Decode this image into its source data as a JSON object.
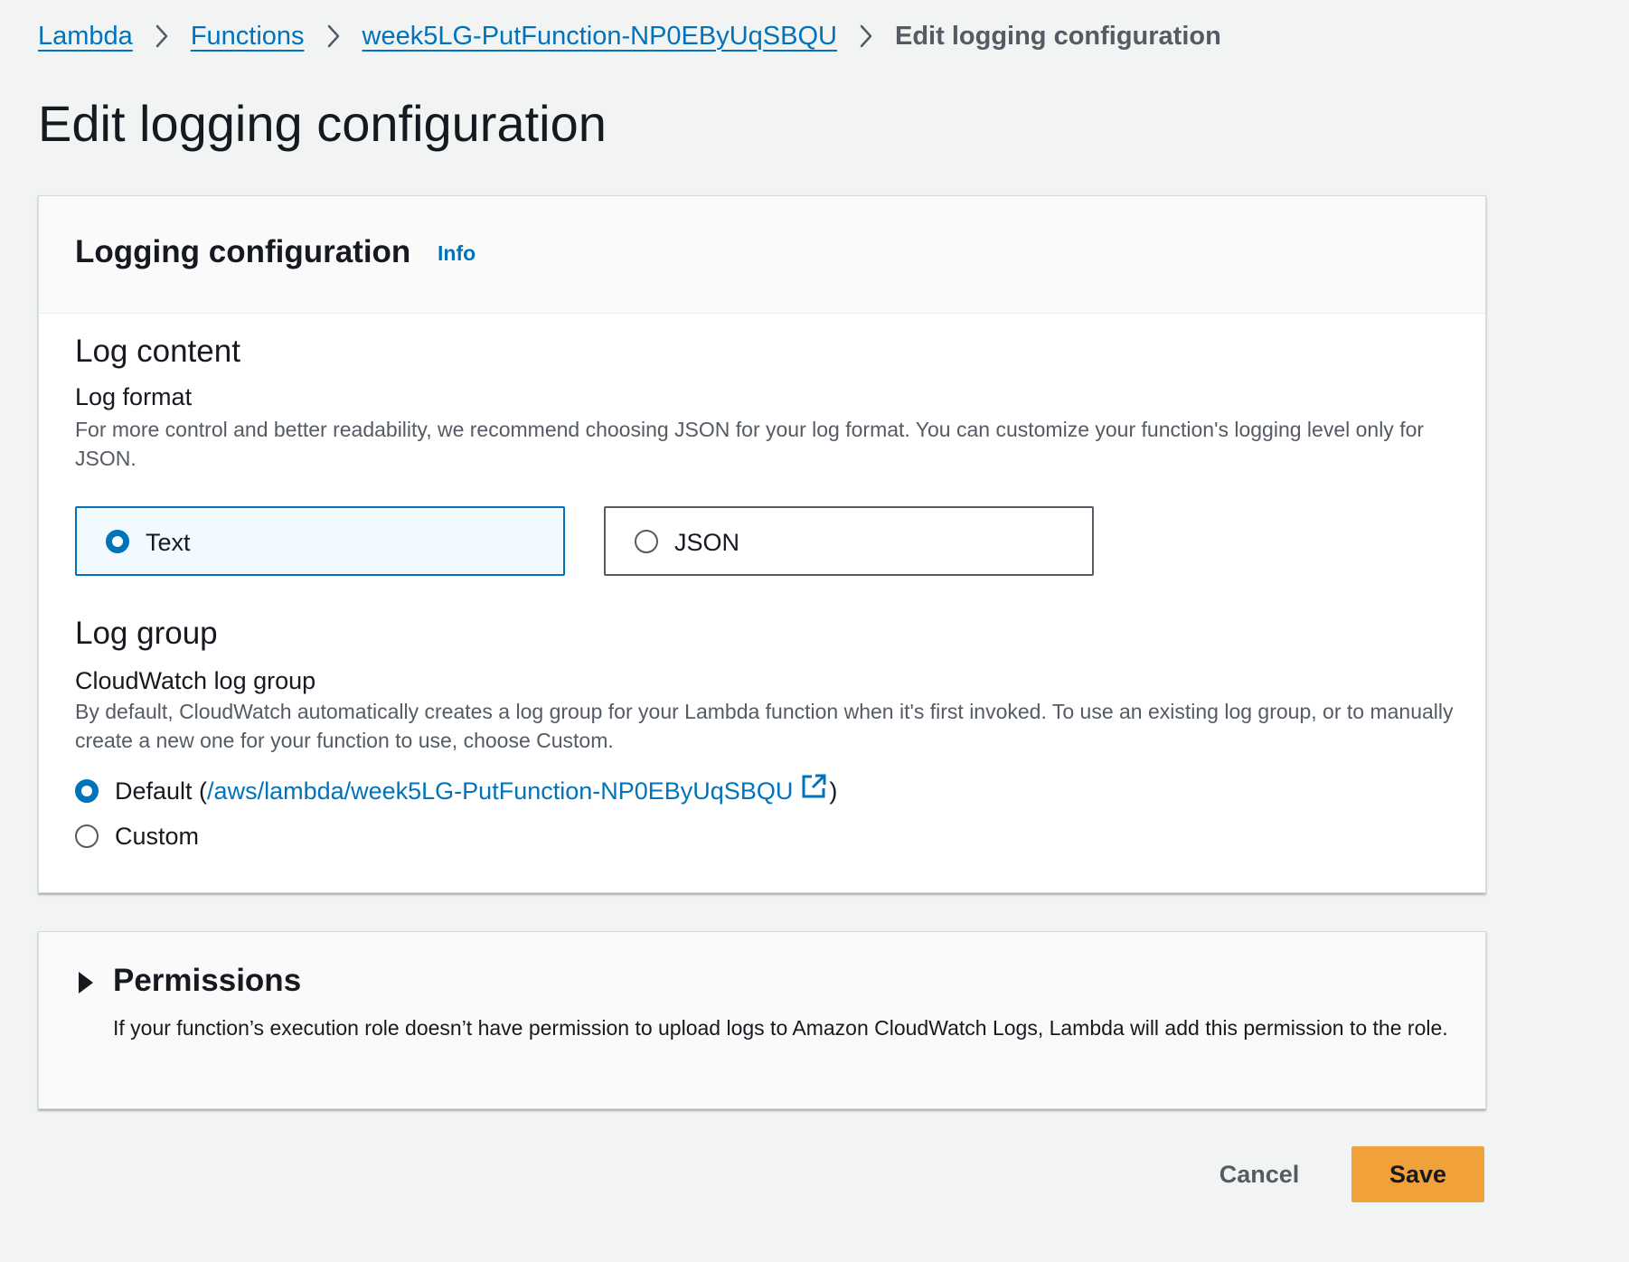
{
  "breadcrumb": {
    "items": [
      {
        "label": "Lambda"
      },
      {
        "label": "Functions"
      },
      {
        "label": "week5LG-PutFunction-NP0EByUqSBQU"
      }
    ],
    "current": "Edit logging configuration"
  },
  "page": {
    "title": "Edit logging configuration"
  },
  "logging_panel": {
    "title": "Logging configuration",
    "info_label": "Info",
    "log_content": {
      "heading": "Log content",
      "format_label": "Log format",
      "format_description": "For more control and better readability, we recommend choosing JSON for your log format. You can customize your function's logging level only for JSON.",
      "options": [
        {
          "label": "Text",
          "selected": true
        },
        {
          "label": "JSON",
          "selected": false
        }
      ]
    },
    "log_group": {
      "heading": "Log group",
      "label": "CloudWatch log group",
      "description": "By default, CloudWatch automatically creates a log group for your Lambda function when it's first invoked. To use an existing log group, or to manually create a new one for your function to use, choose Custom.",
      "default_prefix": "Default (",
      "default_link": "/aws/lambda/week5LG-PutFunction-NP0EByUqSBQU",
      "default_suffix": ")",
      "custom_label": "Custom",
      "selected": "Default"
    }
  },
  "permissions_panel": {
    "title": "Permissions",
    "description": "If your function’s execution role doesn’t have permission to upload logs to Amazon CloudWatch Logs, Lambda will add this permission to the role.",
    "expanded": false
  },
  "footer": {
    "cancel_label": "Cancel",
    "save_label": "Save"
  },
  "colors": {
    "link": "#0073bb",
    "primary_button": "#f0a13a",
    "background": "#f2f3f3"
  },
  "icons": {
    "breadcrumb_separator": "chevron-right-icon",
    "external_link": "external-link-icon",
    "expand": "caret-right-icon"
  }
}
